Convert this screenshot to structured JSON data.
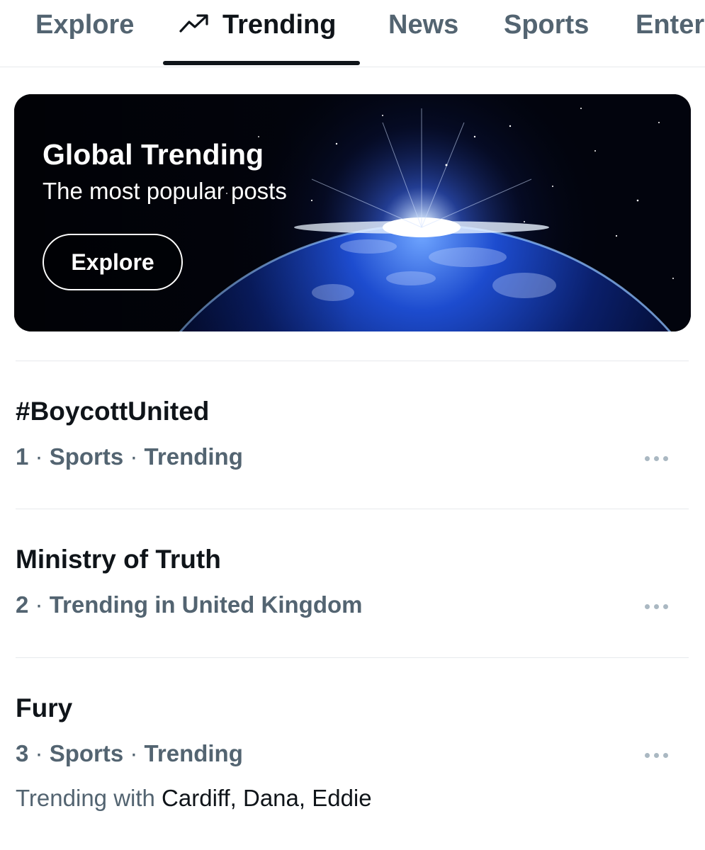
{
  "tabs": [
    {
      "label": "Explore",
      "active": false
    },
    {
      "label": "Trending",
      "active": true,
      "icon": "trending-arrow-icon"
    },
    {
      "label": "News",
      "active": false
    },
    {
      "label": "Sports",
      "active": false
    },
    {
      "label": "Enter",
      "active": false
    }
  ],
  "banner": {
    "title": "Global Trending",
    "subtitle": "The most popular posts",
    "button_label": "Explore"
  },
  "trends": [
    {
      "rank": "1",
      "title": "#BoycottUnited",
      "context": [
        "Sports",
        "Trending"
      ]
    },
    {
      "rank": "2",
      "title": "Ministry of Truth",
      "context": [
        "Trending in United Kingdom"
      ]
    },
    {
      "rank": "3",
      "title": "Fury",
      "context": [
        "Sports",
        "Trending"
      ],
      "trending_with_label": "Trending with",
      "trending_with": "Cardiff, Dana, Eddie"
    }
  ],
  "colors": {
    "primary_text": "#0f1419",
    "secondary_text": "#536471",
    "divider": "#e6e9ec",
    "more_dots": "#aab8c2"
  }
}
